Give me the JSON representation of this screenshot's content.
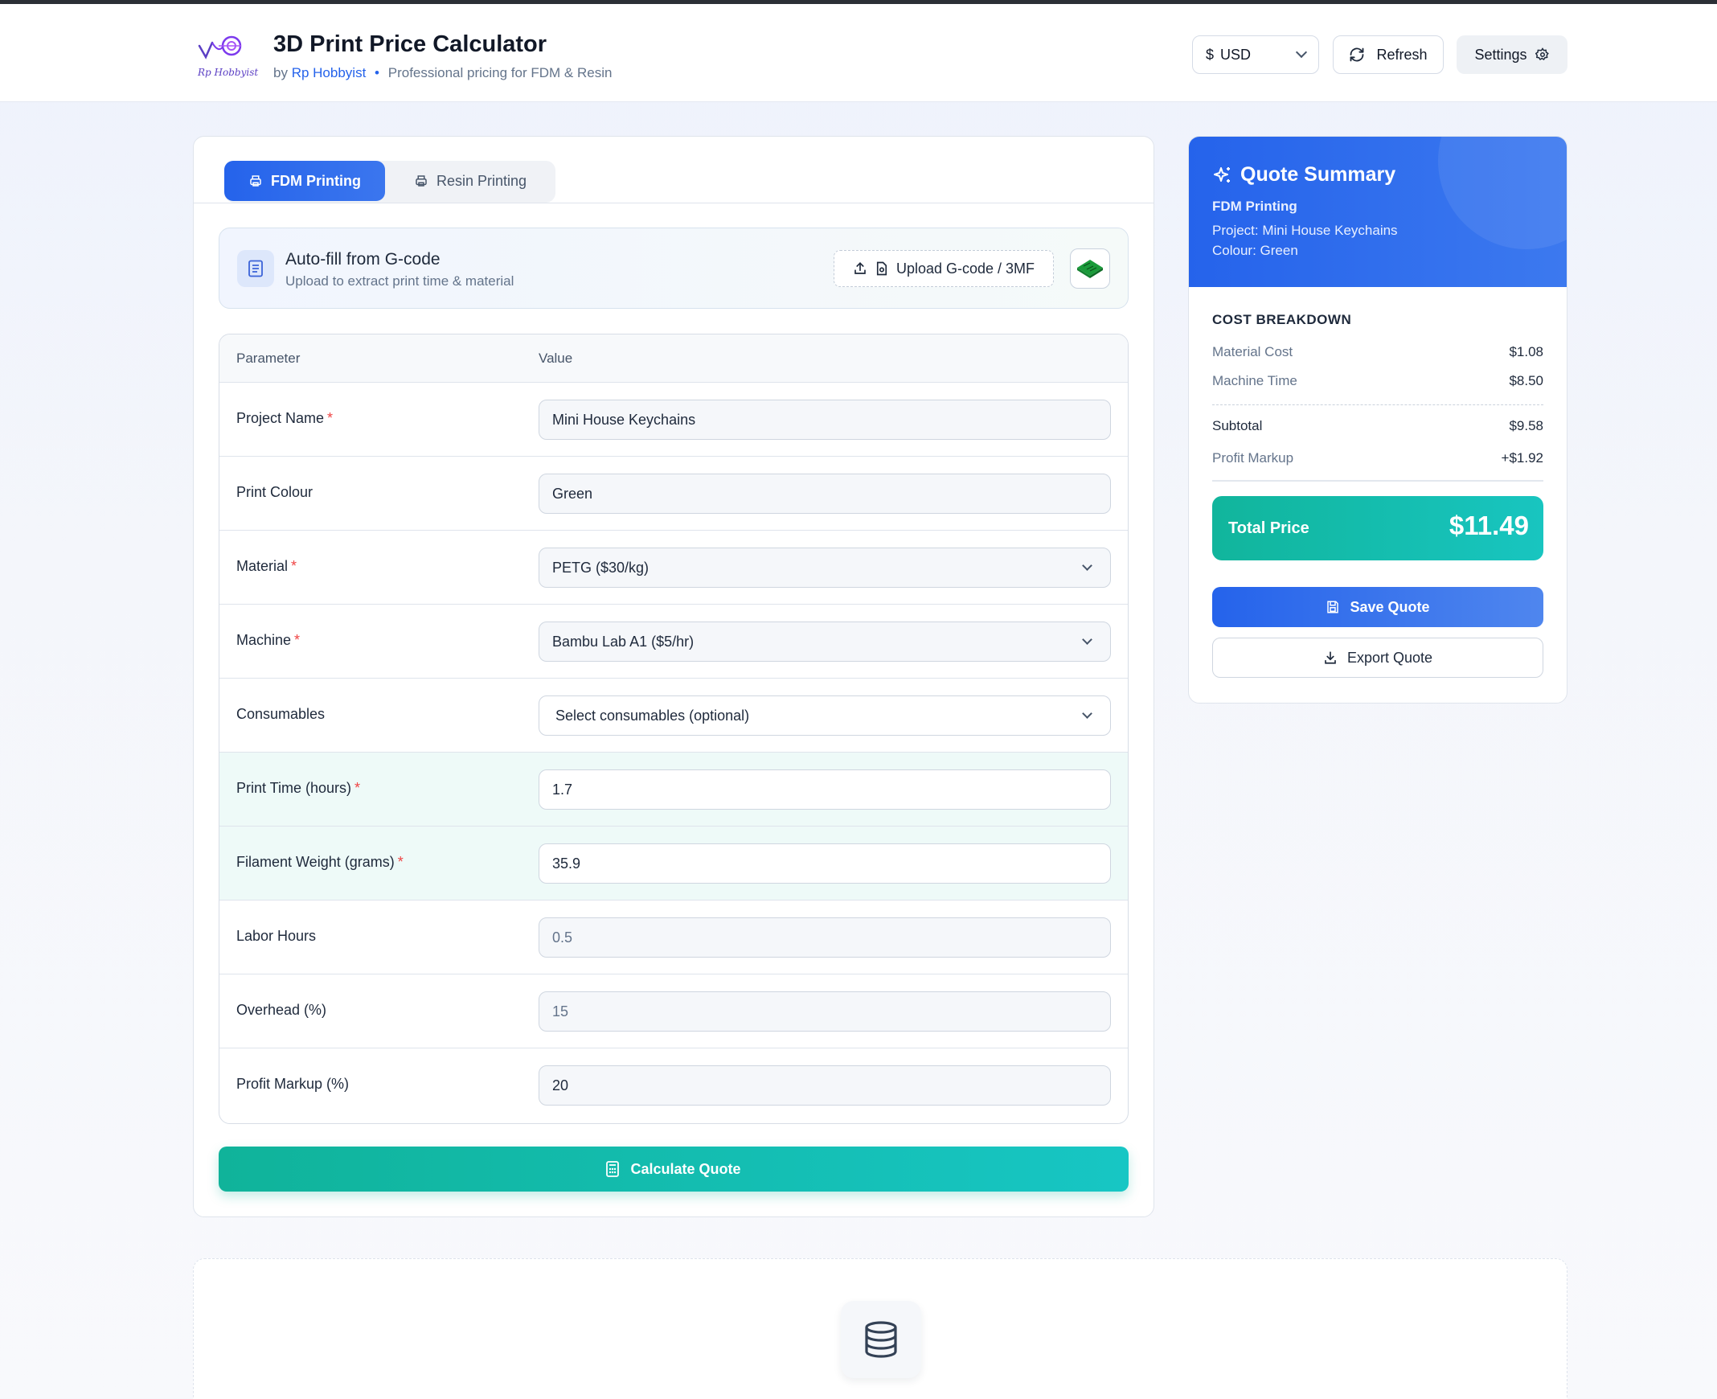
{
  "header": {
    "logo_text": "Rp Hobbyist",
    "title": "3D Print Price Calculator",
    "subtitle_prefix": "by",
    "brand": "Rp Hobbyist",
    "separator": "•",
    "tagline": "Professional pricing for FDM & Resin",
    "currency_symbol": "$",
    "currency": "USD",
    "refresh_label": "Refresh",
    "settings_label": "Settings"
  },
  "tabs": [
    {
      "label": "FDM Printing",
      "active": true,
      "icon": "printer-icon"
    },
    {
      "label": "Resin Printing",
      "active": false,
      "icon": "printer-icon"
    }
  ],
  "gcode": {
    "title": "Auto-fill from G-code",
    "subtitle": "Upload to extract print time & material",
    "upload_label": "Upload G-code / 3MF",
    "bambu_icon": "bambu-lab-icon"
  },
  "table": {
    "col_param": "Parameter",
    "col_value": "Value",
    "rows": [
      {
        "label": "Project Name",
        "required": "*",
        "value": "Mini House Keychains",
        "type": "input"
      },
      {
        "label": "Print Colour",
        "required": "",
        "value": "Green",
        "type": "input"
      },
      {
        "label": "Material",
        "required": "*",
        "value": "PETG ($30/kg)",
        "type": "select"
      },
      {
        "label": "Machine",
        "required": "*",
        "value": "Bambu Lab A1 ($5/hr)",
        "type": "select"
      },
      {
        "label": "Consumables",
        "required": "",
        "value": "Select consumables (optional)",
        "type": "select"
      },
      {
        "label": "Print Time (hours)",
        "required": "*",
        "value": "1.7",
        "type": "input"
      },
      {
        "label": "Filament Weight (grams)",
        "required": "*",
        "value": "35.9",
        "type": "input"
      },
      {
        "label": "Labor Hours",
        "required": "",
        "value": "0.5",
        "type": "input"
      },
      {
        "label": "Overhead (%)",
        "required": "",
        "value": "15",
        "type": "input"
      },
      {
        "label": "Profit Markup (%)",
        "required": "",
        "value": "20",
        "type": "input"
      }
    ]
  },
  "calculate_label": "Calculate Quote",
  "summary": {
    "title": "Quote Summary",
    "type": "FDM Printing",
    "project": "Project: Mini House Keychains",
    "colour": "Colour: Green",
    "breakdown_title": "COST BREAKDOWN",
    "material_cost_label": "Material Cost",
    "material_cost": "$1.08",
    "machine_time_label": "Machine Time",
    "machine_time": "$8.50",
    "subtotal_label": "Subtotal",
    "subtotal": "$9.58",
    "markup_label": "Profit Markup",
    "markup": "+$1.92",
    "total_label": "Total Price",
    "total": "$11.49",
    "save_label": "Save Quote",
    "export_label": "Export Quote"
  },
  "colors": {
    "primary": "#2563eb",
    "teal": "#14b8a6",
    "required": "#ef4444"
  }
}
